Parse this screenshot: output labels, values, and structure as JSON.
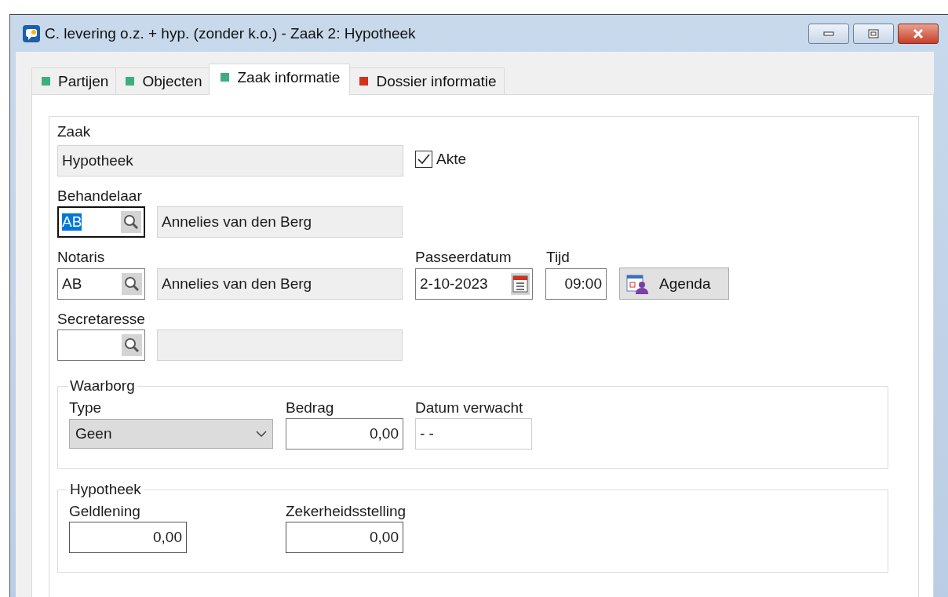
{
  "window": {
    "title": "C. levering o.z. + hyp. (zonder k.o.) - Zaak 2: Hypotheek"
  },
  "tabs": [
    {
      "label": "Partijen",
      "color": "#3fae7f",
      "selected": false
    },
    {
      "label": "Objecten",
      "color": "#3fae7f",
      "selected": false
    },
    {
      "label": "Zaak informatie",
      "color": "#3fae7f",
      "selected": true
    },
    {
      "label": "Dossier informatie",
      "color": "#d0321e",
      "selected": false
    }
  ],
  "zaak": {
    "label": "Zaak",
    "value": "Hypotheek"
  },
  "akte": {
    "label": "Akte",
    "checked": true
  },
  "persons": [
    {
      "label": "Behandelaar",
      "code": "AB",
      "name": "Annelies van den Berg",
      "focused": true
    },
    {
      "label": "Notaris",
      "code": "AB",
      "name": "Annelies van den Berg",
      "focused": false
    },
    {
      "label": "Secretaresse",
      "focused": false
    }
  ],
  "passeerdatum": {
    "label": "Passeerdatum",
    "value": "2-10-2023"
  },
  "tijd": {
    "label": "Tijd",
    "value": "09:00"
  },
  "agenda_button": {
    "label": "Agenda"
  },
  "waarborg": {
    "title": "Waarborg",
    "type": {
      "label": "Type",
      "value": "Geen"
    },
    "bedrag": {
      "label": "Bedrag",
      "value": "0,00"
    },
    "datum_verwacht": {
      "label": "Datum verwacht",
      "value": "- -"
    }
  },
  "hypotheek": {
    "title": "Hypotheek",
    "geldlening": {
      "label": "Geldlening",
      "value": "0,00"
    },
    "zekerheidsstelling": {
      "label": "Zekerheidsstelling",
      "value": "0,00"
    }
  }
}
